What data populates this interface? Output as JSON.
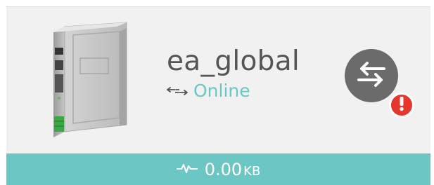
{
  "device": {
    "name": "ea_global",
    "status": "Online"
  },
  "traffic": {
    "value": "0.00",
    "unit": "KB"
  },
  "icons": {
    "device_image": "router-device-icon",
    "status": "link-arrows-icon",
    "sync": "swap-arrows-icon",
    "alert": "exclamation-alert-icon",
    "traffic": "pulse-activity-icon"
  },
  "colors": {
    "accent": "#6cc7c4",
    "alert": "#e5372d",
    "sync_button": "#6b6b6b",
    "name_text": "#555555"
  }
}
